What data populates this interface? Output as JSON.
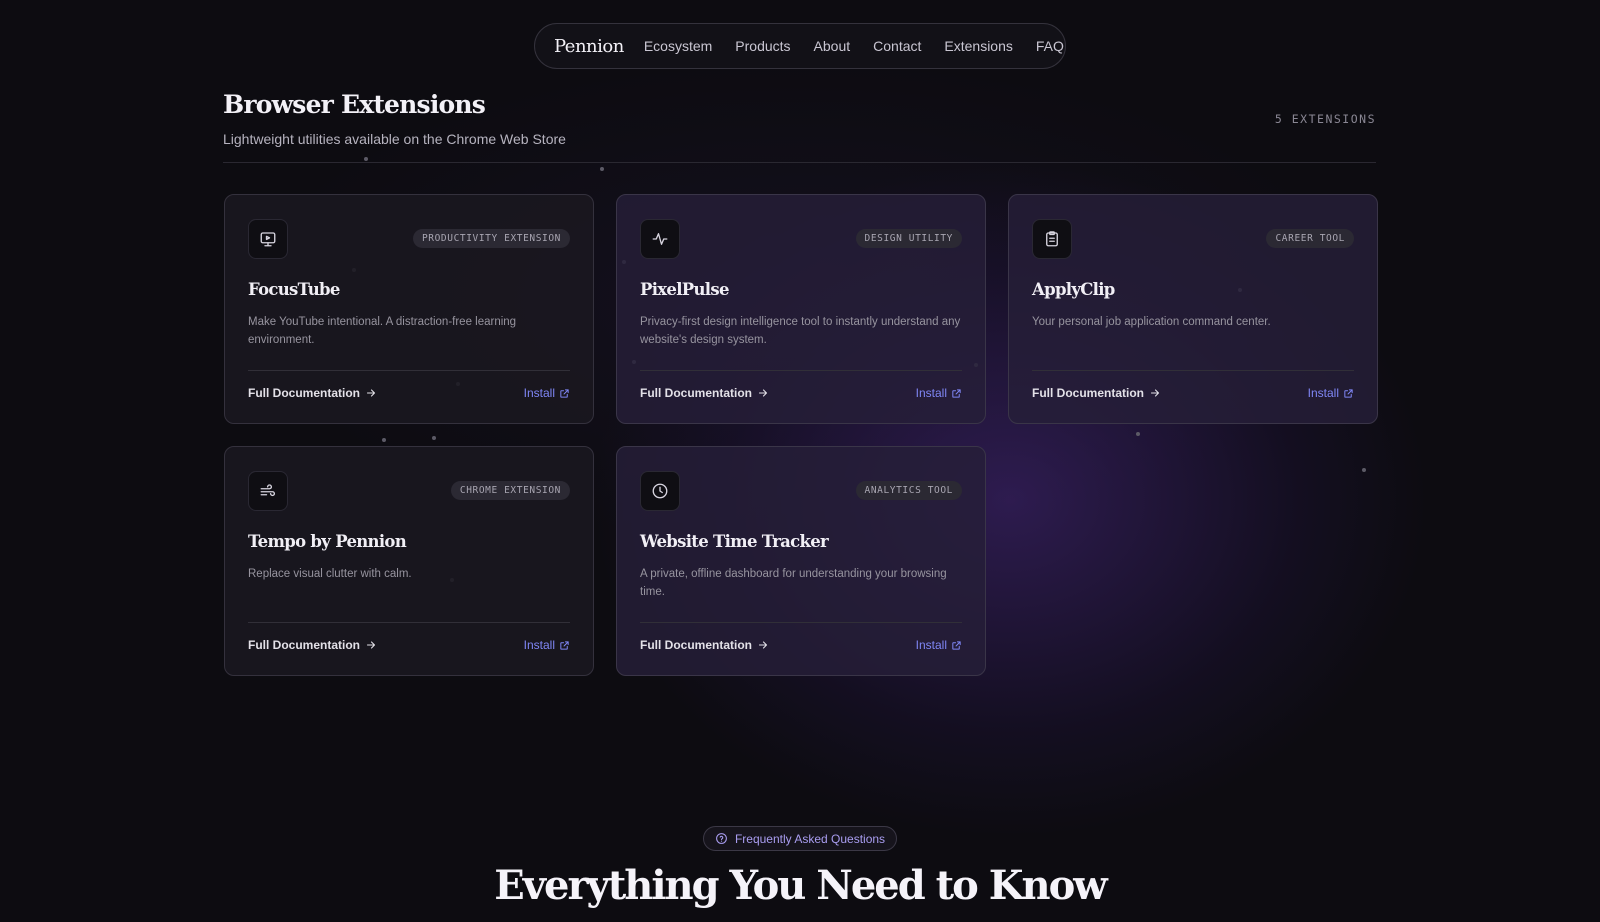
{
  "nav": {
    "brand": "Pennion",
    "links": [
      "Ecosystem",
      "Products",
      "About",
      "Contact",
      "Extensions",
      "FAQ"
    ]
  },
  "header": {
    "title": "Browser Extensions",
    "subtitle": "Lightweight utilities available on the Chrome Web Store",
    "count": "5 EXTENSIONS"
  },
  "cards": [
    {
      "icon": "monitor-play-icon",
      "badge": "PRODUCTIVITY EXTENSION",
      "name": "FocusTube",
      "description": "Make YouTube intentional. A distraction-free learning environment.",
      "doc_label": "Full Documentation",
      "install_label": "Install"
    },
    {
      "icon": "activity-pulse-icon",
      "badge": "DESIGN UTILITY",
      "name": "PixelPulse",
      "description": "Privacy-first design intelligence tool to instantly understand any website's design system.",
      "doc_label": "Full Documentation",
      "install_label": "Install"
    },
    {
      "icon": "clipboard-icon",
      "badge": "CAREER TOOL",
      "name": "ApplyClip",
      "description": "Your personal job application command center.",
      "doc_label": "Full Documentation",
      "install_label": "Install"
    },
    {
      "icon": "wind-icon",
      "badge": "CHROME EXTENSION",
      "name": "Tempo by Pennion",
      "description": "Replace visual clutter with calm.",
      "doc_label": "Full Documentation",
      "install_label": "Install"
    },
    {
      "icon": "clock-icon",
      "badge": "ANALYTICS TOOL",
      "name": "Website Time Tracker",
      "description": "A private, offline dashboard for understanding your browsing time.",
      "doc_label": "Full Documentation",
      "install_label": "Install"
    }
  ],
  "faq": {
    "pill": "Frequently Asked Questions",
    "title": "Everything You Need to Know"
  },
  "colors": {
    "accent": "#7f86f5",
    "background": "#0d0c11"
  }
}
